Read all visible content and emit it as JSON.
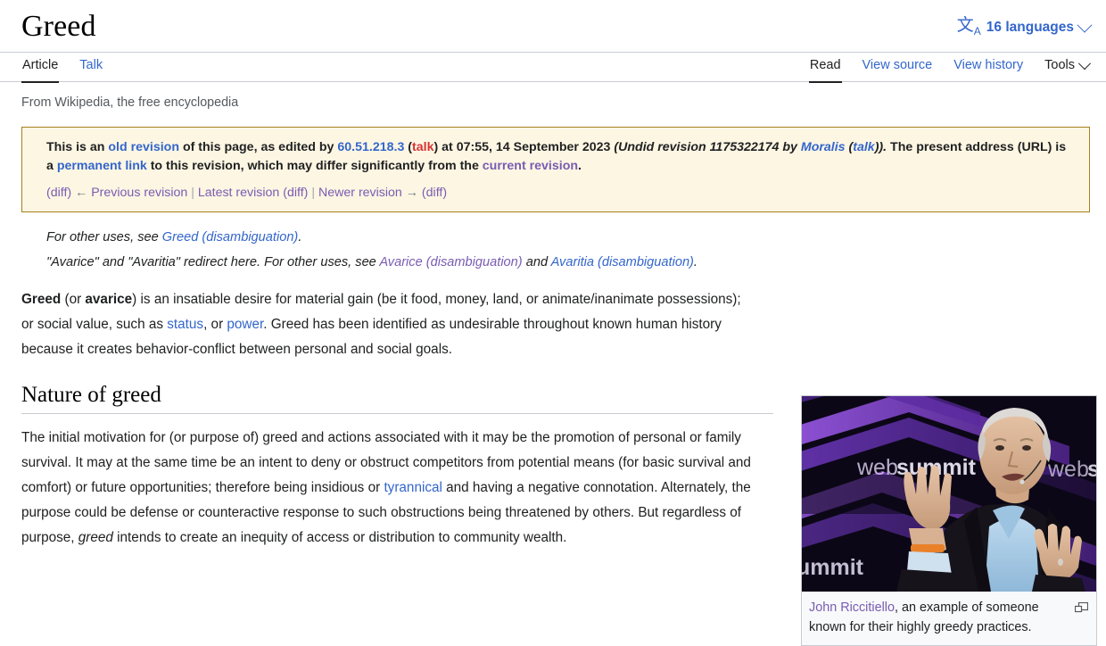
{
  "header": {
    "title": "Greed",
    "language_selector": {
      "icon": "language-icon",
      "glyph": "文",
      "glyph_sub": "A",
      "label": "16 languages",
      "chevron": "chevron-down-icon"
    }
  },
  "tabs": {
    "left": [
      {
        "label": "Article",
        "active": true
      },
      {
        "label": "Talk",
        "active": false
      }
    ],
    "right": [
      {
        "label": "Read",
        "active": true
      },
      {
        "label": "View source",
        "active": false
      },
      {
        "label": "View history",
        "active": false
      }
    ],
    "tools": {
      "label": "Tools",
      "chevron": "chevron-down-icon"
    }
  },
  "site_sub": "From Wikipedia, the free encyclopedia",
  "revision_banner": {
    "text_1": "This is an ",
    "link_old_revision": "old revision",
    "text_2": " of this page, as edited by ",
    "link_ip": "60.51.218.3",
    "text_3": " (",
    "link_talk": "talk",
    "text_4": ") at ",
    "timestamp": "07:55, 14 September 2023",
    "undid_text": " (Undid revision 1175322174 by ",
    "link_moralis": "Moralis",
    "undid_text_2": " (",
    "link_moralis_talk": "talk",
    "undid_text_3": ")). ",
    "text_5": "The present address (URL) is a ",
    "link_permanent": "permanent link",
    "text_6": " to this revision, which may differ significantly from the ",
    "link_current": "current revision",
    "text_7": ".",
    "nav": {
      "diff_1": "(diff)",
      "arrow_prev": "←",
      "previous_revision": "Previous revision",
      "sep_1": "|",
      "latest_revision": "Latest revision",
      "diff_2": "(diff)",
      "sep_2": "|",
      "newer_revision": "Newer revision",
      "arrow_next": "→",
      "diff_3": "(diff)"
    }
  },
  "hatnotes": [
    {
      "pre": "For other uses, see ",
      "link_1": "Greed (disambiguation)",
      "mid": "",
      "link_2": "",
      "post": "."
    },
    {
      "pre": "\"Avarice\" and \"Avaritia\" redirect here. For other uses, see ",
      "link_1": "Avarice (disambiguation)",
      "mid": " and ",
      "link_2": "Avaritia (disambiguation)",
      "post": "."
    }
  ],
  "lead": {
    "bold_1": "Greed",
    "t1": " (or ",
    "bold_2": "avarice",
    "t2": ") is an insatiable desire for material gain (be it food, money, land, or animate/inanimate possessions); or social value, such as ",
    "link_status": "status",
    "t3": ", or ",
    "link_power": "power",
    "t4": ". Greed has been identified as undesirable throughout known human history because it creates behavior-conflict between personal and social goals."
  },
  "section": {
    "heading": "Nature of greed",
    "p1_a": "The initial motivation for (or purpose of) greed and actions associated with it may be the promotion of personal or family survival. It may at the same time be an intent to deny or obstruct competitors from potential means (for basic survival and comfort) or future opportunities; therefore being insidious or ",
    "link_tyrannical": "tyrannical",
    "p1_b": " and having a negative connotation. Alternately, the purpose could be defense or counteractive response to such obstructions being threatened by others. But regardless of purpose, ",
    "italic_greed": "greed",
    "p1_c": " intends to create an inequity of access or distribution to community wealth."
  },
  "thumbnail": {
    "image_alt": "John Riccitiello speaking on a Web Summit stage",
    "stage_text_1": "web",
    "stage_text_1b": "summit",
    "stage_text_2": "web",
    "stage_text_2b": "su",
    "stage_text_3": "ummit",
    "caption_link": "John Riccitiello",
    "caption_rest": ", an example of someone known for their highly greedy practices.",
    "enlarge_icon": "enlarge-icon"
  },
  "colors": {
    "link": "#3366cc",
    "link_visited": "#795cb2",
    "link_red": "#d73333",
    "banner_bg": "#fdf6e3",
    "banner_border": "#a7801f",
    "text": "#202122",
    "rule": "#c8ccd1"
  }
}
